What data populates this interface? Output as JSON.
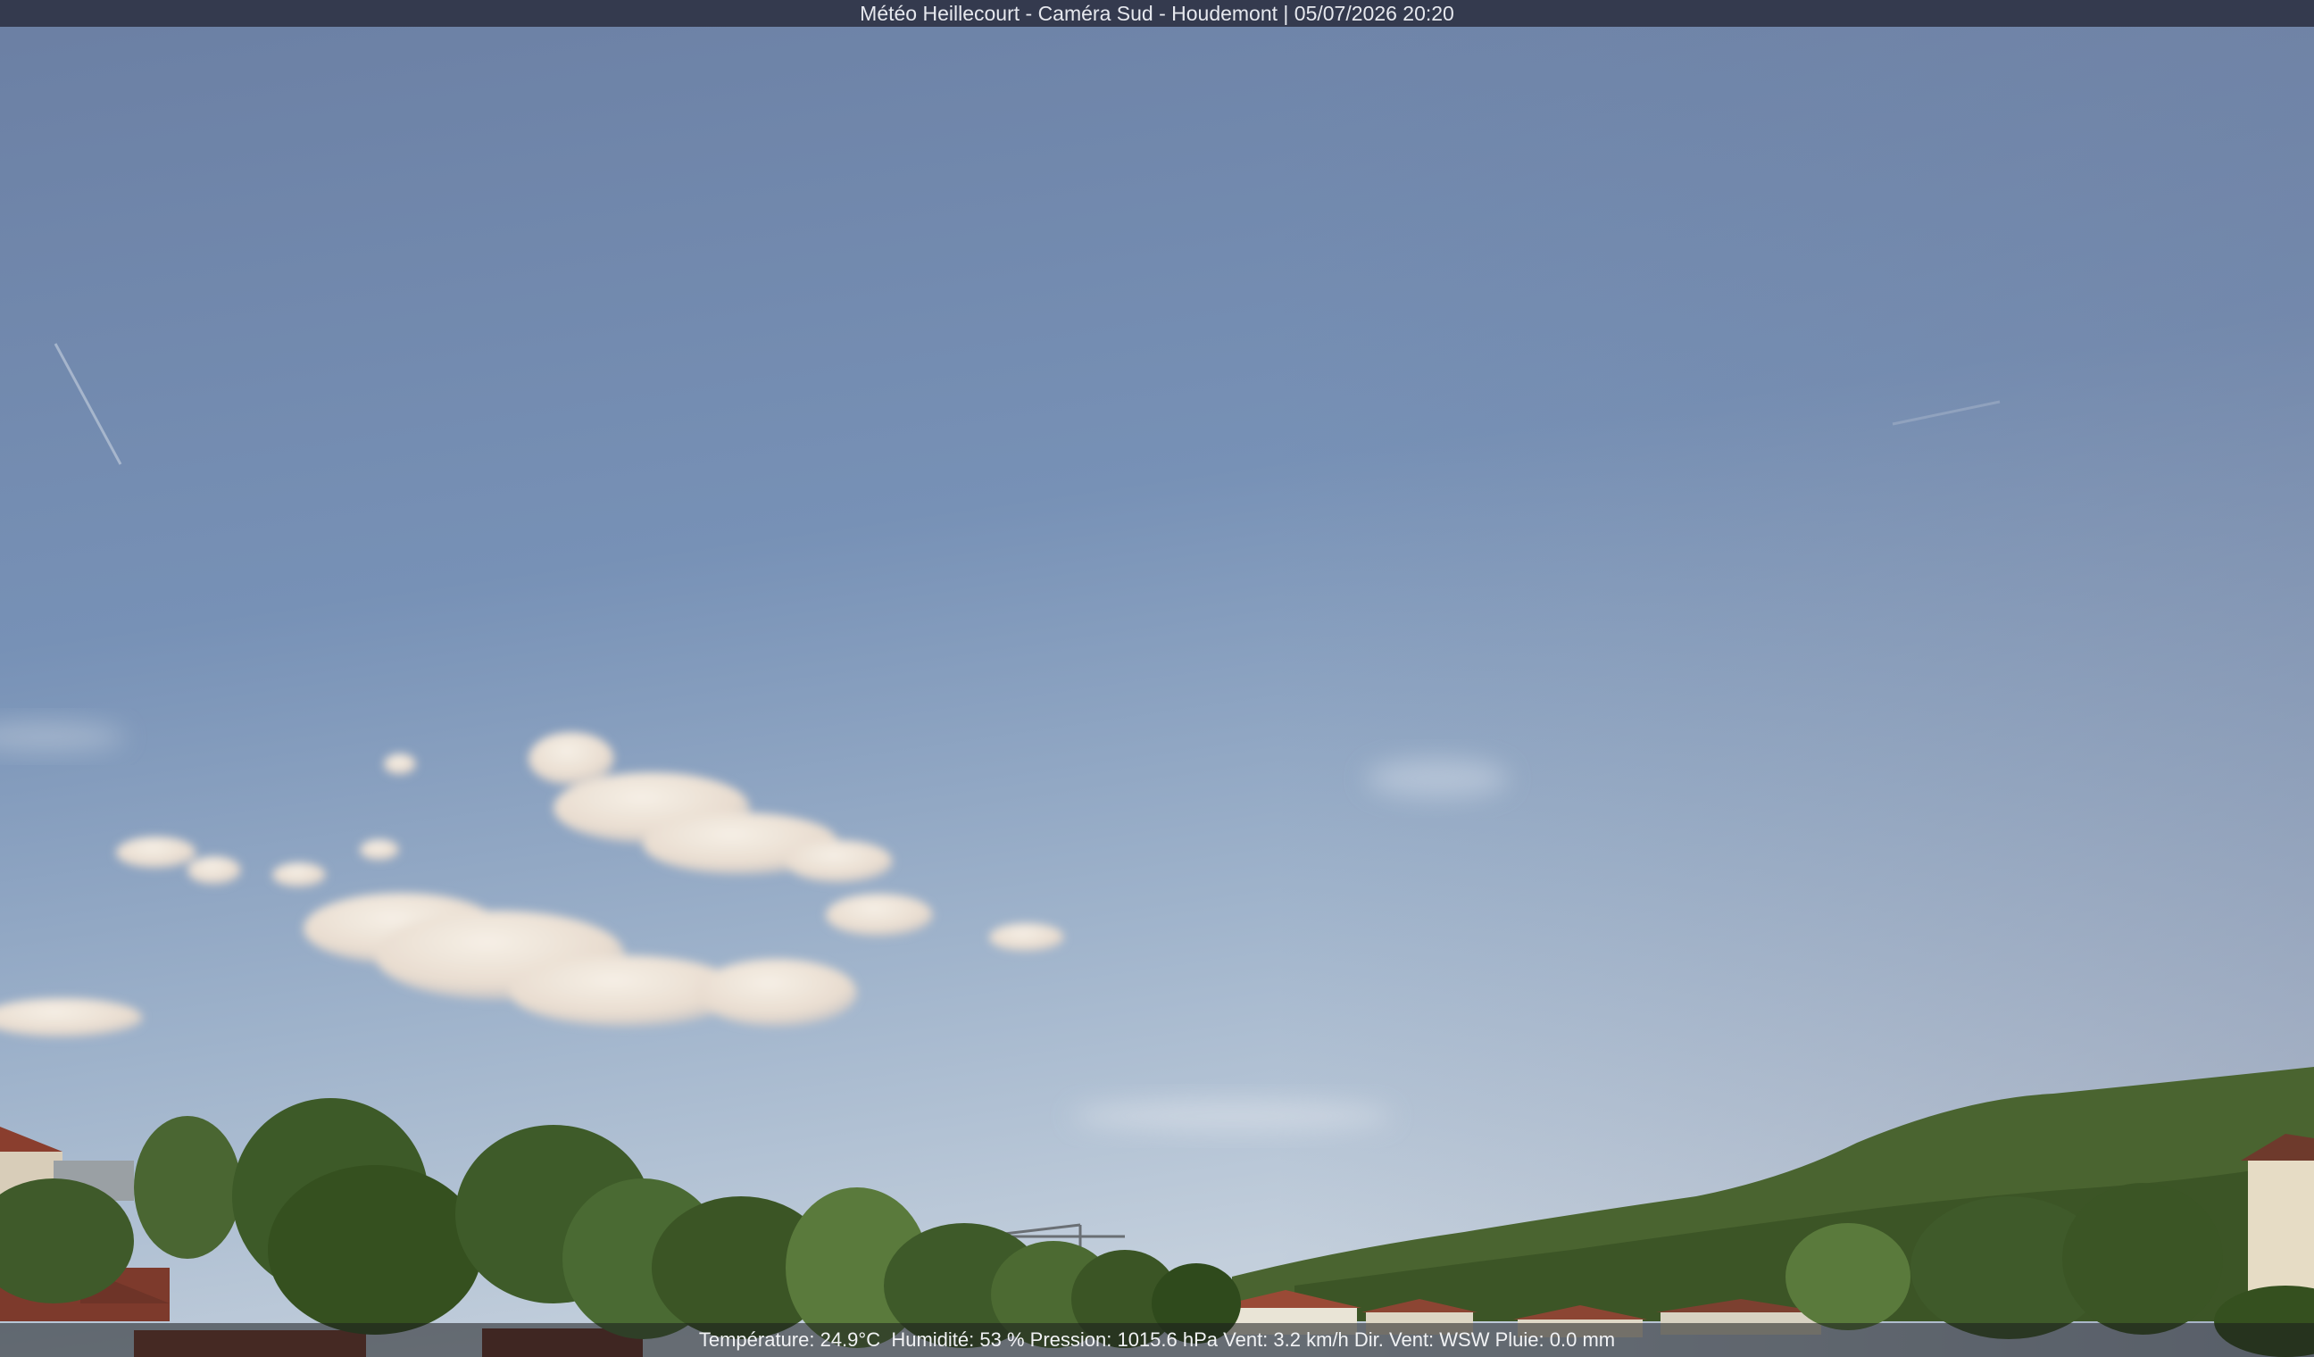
{
  "caption": {
    "title": "Météo Heillecourt - Caméra Sud - Houdemont | 05/07/2026 20:20"
  },
  "weather": {
    "temperature": "Température: 24.9°C",
    "humidity": "Humidité: 53 %",
    "pressure": "Pression: 1015.6 hPa",
    "wind_speed": "Vent: 3.2 km/h",
    "wind_dir": "Dir. Vent: WSW",
    "rain": "Pluie: 0.0 mm"
  },
  "colors": {
    "sky_top": "#6b7fa3",
    "sky_horizon": "#b9c6d6",
    "cloud": "#efe4d8",
    "foliage": "#3f5a2a",
    "roof": "#9a4a36",
    "bar": "#343a4e"
  }
}
